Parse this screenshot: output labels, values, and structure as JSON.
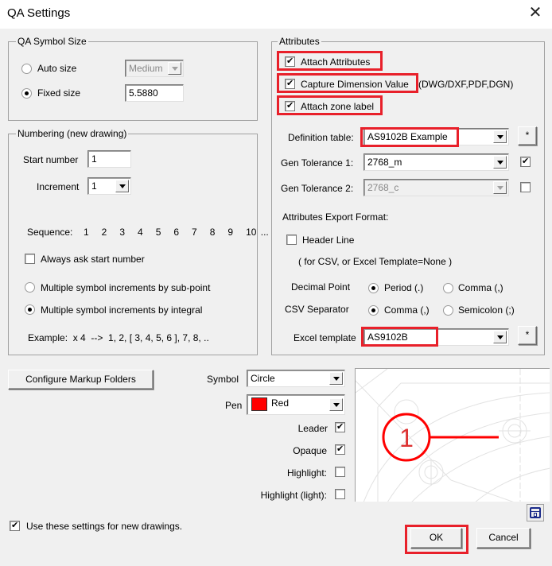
{
  "window": {
    "title": "QA Settings",
    "close_icon": "close-icon"
  },
  "symbol_size": {
    "legend": "QA Symbol Size",
    "auto_size_label": "Auto size",
    "auto_size_selected": false,
    "auto_size_value": "Medium",
    "fixed_size_label": "Fixed size",
    "fixed_size_selected": true,
    "fixed_size_value": "5.5880"
  },
  "numbering": {
    "legend": "Numbering (new drawing)",
    "start_number_label": "Start number",
    "start_number_value": "1",
    "increment_label": "Increment",
    "increment_value": "1",
    "sequence_label": "Sequence:",
    "sequence_values": "1   2   3   4   5   6   7   8   9   10 ...",
    "always_ask_label": "Always ask start number",
    "always_ask_checked": false,
    "sub_point_label": "Multiple symbol increments by sub-point",
    "sub_point_selected": false,
    "integral_label": "Multiple symbol increments by integral",
    "integral_selected": true,
    "example_text": "Example:  x 4  -->  1, 2, [ 3, 4, 5, 6 ], 7, 8, .."
  },
  "attributes": {
    "legend": "Attributes",
    "attach_attributes_label": "Attach Attributes",
    "attach_attributes_checked": true,
    "capture_dimension_label": "Capture Dimension Value",
    "capture_dimension_suffix": "(DWG/DXF,PDF,DGN)",
    "capture_dimension_checked": true,
    "attach_zone_label": "Attach zone label",
    "attach_zone_checked": true,
    "definition_table_label": "Definition table:",
    "definition_table_value": "AS9102B Example",
    "definition_table_button": "*",
    "gen_tol1_label": "Gen Tolerance 1:",
    "gen_tol1_value": "2768_m",
    "gen_tol1_checked": true,
    "gen_tol2_label": "Gen Tolerance 2:",
    "gen_tol2_value": "2768_c",
    "gen_tol2_checked": false,
    "export_format_label": "Attributes Export Format:",
    "header_line_label": "Header Line",
    "header_line_checked": false,
    "header_line_note": "( for CSV, or Excel Template=None )",
    "decimal_point_label": "Decimal Point",
    "decimal_period_label": "Period (.)",
    "decimal_period_selected": true,
    "decimal_comma_label": "Comma (,)",
    "decimal_comma_selected": false,
    "csv_separator_label": "CSV Separator",
    "csv_comma_label": "Comma (,)",
    "csv_comma_selected": true,
    "csv_semicolon_label": "Semicolon (;)",
    "csv_semicolon_selected": false,
    "excel_template_label": "Excel template",
    "excel_template_value": "AS9102B",
    "excel_template_button": "*"
  },
  "markup": {
    "configure_folders_button": "Configure Markup Folders",
    "symbol_label": "Symbol",
    "symbol_value": "Circle",
    "pen_label": "Pen",
    "pen_value": "Red",
    "pen_color": "#ff0000",
    "leader_label": "Leader",
    "leader_checked": true,
    "opaque_label": "Opaque",
    "opaque_checked": true,
    "highlight_label": "Highlight:",
    "highlight_checked": false,
    "highlight_light_label": "Highlight (light):",
    "highlight_light_checked": false,
    "preview_balloon_number": "1"
  },
  "footer": {
    "use_settings_label": "Use these settings for new drawings.",
    "use_settings_checked": true,
    "ok_button": "OK",
    "cancel_button": "Cancel"
  },
  "colors": {
    "annotation_red": "#e8202a",
    "balloon_red": "#ff0000"
  }
}
